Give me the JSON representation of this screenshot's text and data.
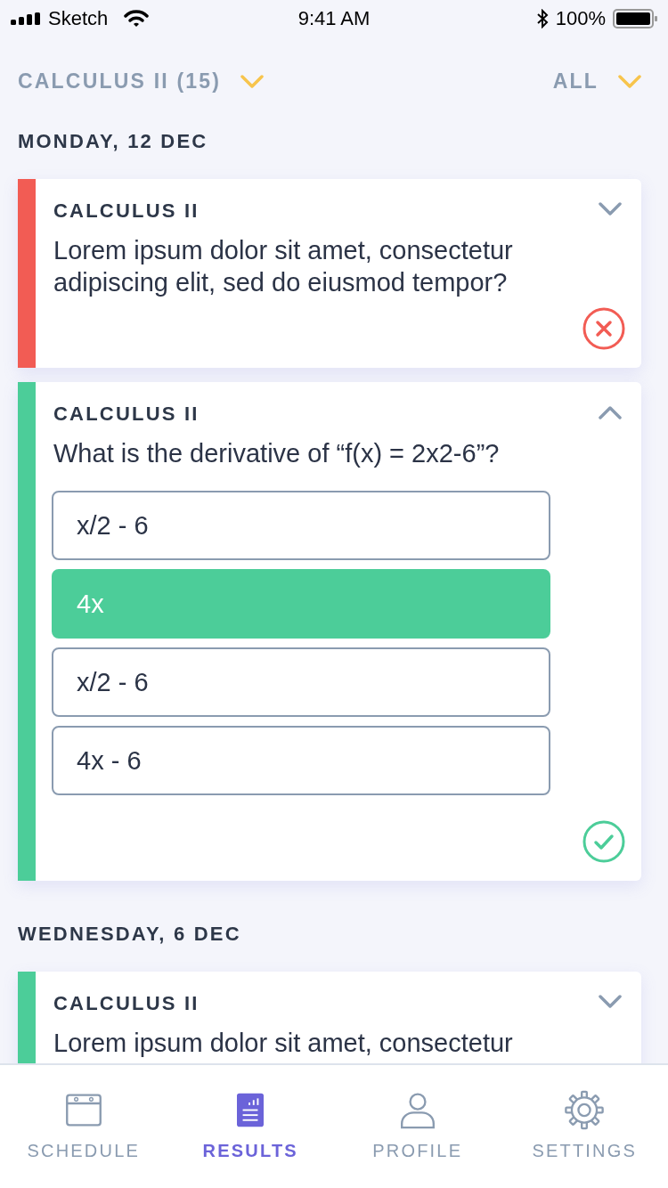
{
  "status_bar": {
    "carrier": "Sketch",
    "time": "9:41 AM",
    "battery": "100%"
  },
  "filters": [
    {
      "label": "CALCULUS II (15)"
    },
    {
      "label": "ALL"
    }
  ],
  "sections": [
    {
      "date": "MONDAY, 12 DEC",
      "cards": [
        {
          "subject": "CALCULUS II",
          "question": "Lorem ipsum dolor sit amet, consectetur adipiscing elit, sed do eiusmod tempor?",
          "color": "#f25c54",
          "expanded": false,
          "correct": false
        },
        {
          "subject": "CALCULUS II",
          "question": "What is the derivative of “f(x) = 2x2-6”?",
          "color": "#4ccd99",
          "expanded": true,
          "correct": true,
          "options": [
            {
              "label": "x/2 - 6",
              "selected": false
            },
            {
              "label": "4x",
              "selected": true
            },
            {
              "label": "x/2 - 6",
              "selected": false
            },
            {
              "label": "4x - 6",
              "selected": false
            }
          ]
        }
      ]
    },
    {
      "date": "WEDNESDAY, 6 DEC",
      "cards": [
        {
          "subject": "CALCULUS II",
          "question": "Lorem ipsum dolor sit amet, consectetur",
          "color": "#4ccd99",
          "expanded": false
        }
      ]
    }
  ],
  "tabs": [
    {
      "label": "SCHEDULE",
      "selected": false
    },
    {
      "label": "RESULTS",
      "selected": true
    },
    {
      "label": "PROFILE",
      "selected": false
    },
    {
      "label": "SETTINGS",
      "selected": false
    }
  ]
}
